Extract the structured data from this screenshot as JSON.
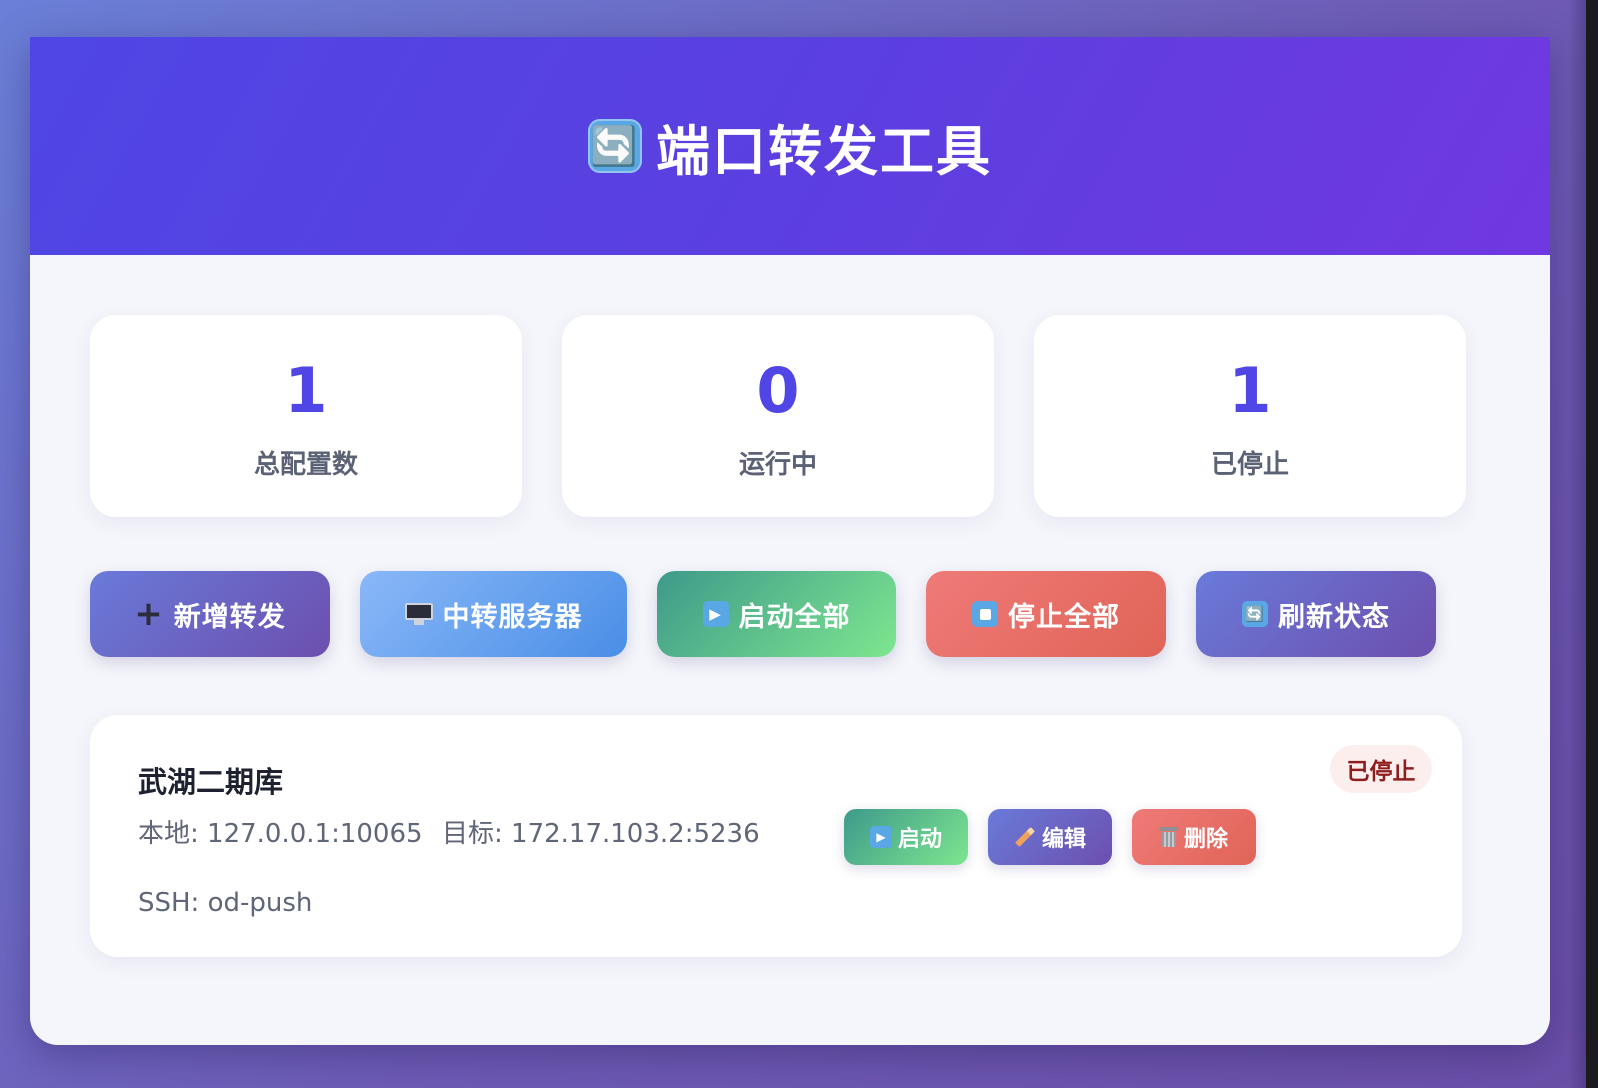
{
  "header": {
    "icon": "arrows-counterclockwise-icon",
    "icon_glyph": "🔄",
    "title": "端口转发工具"
  },
  "stats": [
    {
      "value": "1",
      "label": "总配置数"
    },
    {
      "value": "0",
      "label": "运行中"
    },
    {
      "value": "1",
      "label": "已停止"
    }
  ],
  "toolbar": {
    "add_label": "新增转发",
    "add_icon": "+",
    "relay_label": "中转服务器",
    "start_all_label": "启动全部",
    "start_all_icon_glyph": "▶",
    "stop_all_label": "停止全部",
    "refresh_label": "刷新状态",
    "refresh_icon_glyph": "🔄"
  },
  "configs": [
    {
      "name": "武湖二期库",
      "local": "本地: 127.0.0.1:10065",
      "target": "目标: 172.17.103.2:5236",
      "ssh": "SSH: od-push",
      "status": "已停止",
      "start_label": "启动",
      "start_icon_glyph": "▶",
      "edit_label": "编辑",
      "delete_label": "删除"
    }
  ],
  "colors": {
    "accent": "#4f46e5",
    "header_start": "#4f46e5",
    "header_end": "#7038e0",
    "stopped_badge_bg": "#fdeeee",
    "stopped_badge_text": "#8e1d1d",
    "start_green": "#7ee68f",
    "stop_red": "#e06457",
    "relay_blue": "#4a8ee6"
  }
}
